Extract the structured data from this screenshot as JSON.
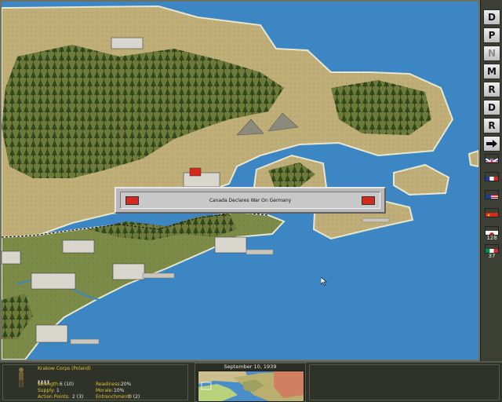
{
  "dialog": {
    "message": "Canada Declares War On Germany"
  },
  "sidebar": {
    "buttons": [
      {
        "label": "D",
        "enabled": true
      },
      {
        "label": "P",
        "enabled": true
      },
      {
        "label": "N",
        "enabled": false
      },
      {
        "label": "M",
        "enabled": true
      },
      {
        "label": "R",
        "enabled": true
      },
      {
        "label": "D",
        "enabled": true
      },
      {
        "label": "R",
        "enabled": true
      }
    ],
    "end_turn_icon": "arrow-right-icon",
    "flags": [
      {
        "country": "United Kingdom",
        "icon": "uk-flag-icon",
        "value": ""
      },
      {
        "country": "France",
        "icon": "france-flag-icon",
        "value": ""
      },
      {
        "country": "United States",
        "icon": "usa-flag-icon",
        "value": ""
      },
      {
        "country": "USSR",
        "icon": "ussr-flag-icon",
        "value": ""
      },
      {
        "country": "Japan",
        "icon": "japan-flag-icon",
        "value": "128"
      },
      {
        "country": "Italy",
        "icon": "italy-flag-icon",
        "value": "37"
      }
    ]
  },
  "unit": {
    "name": "Krakow Corps (Poland)",
    "strength_label": "Strength:",
    "strength_value": "6 (10)",
    "supply_label": "Supply:",
    "supply_value": "1",
    "action_label": "Action Points:",
    "action_value": "2 (3)",
    "readiness_label": "Readiness:",
    "readiness_value": "20%",
    "morale_label": "Morale:",
    "morale_value": "10%",
    "entrench_label": "Entrenchment:",
    "entrench_value": "0 (2)",
    "pips": 4
  },
  "date": "September 10, 1939",
  "colors": {
    "sea": "#3b86c3",
    "land_neutral": "#bfae77",
    "land_axis_front": "#7d8b49",
    "forest": "#3e5a25",
    "ussr_red": "#d42a1e",
    "label_yellow": "#e3c02f"
  }
}
